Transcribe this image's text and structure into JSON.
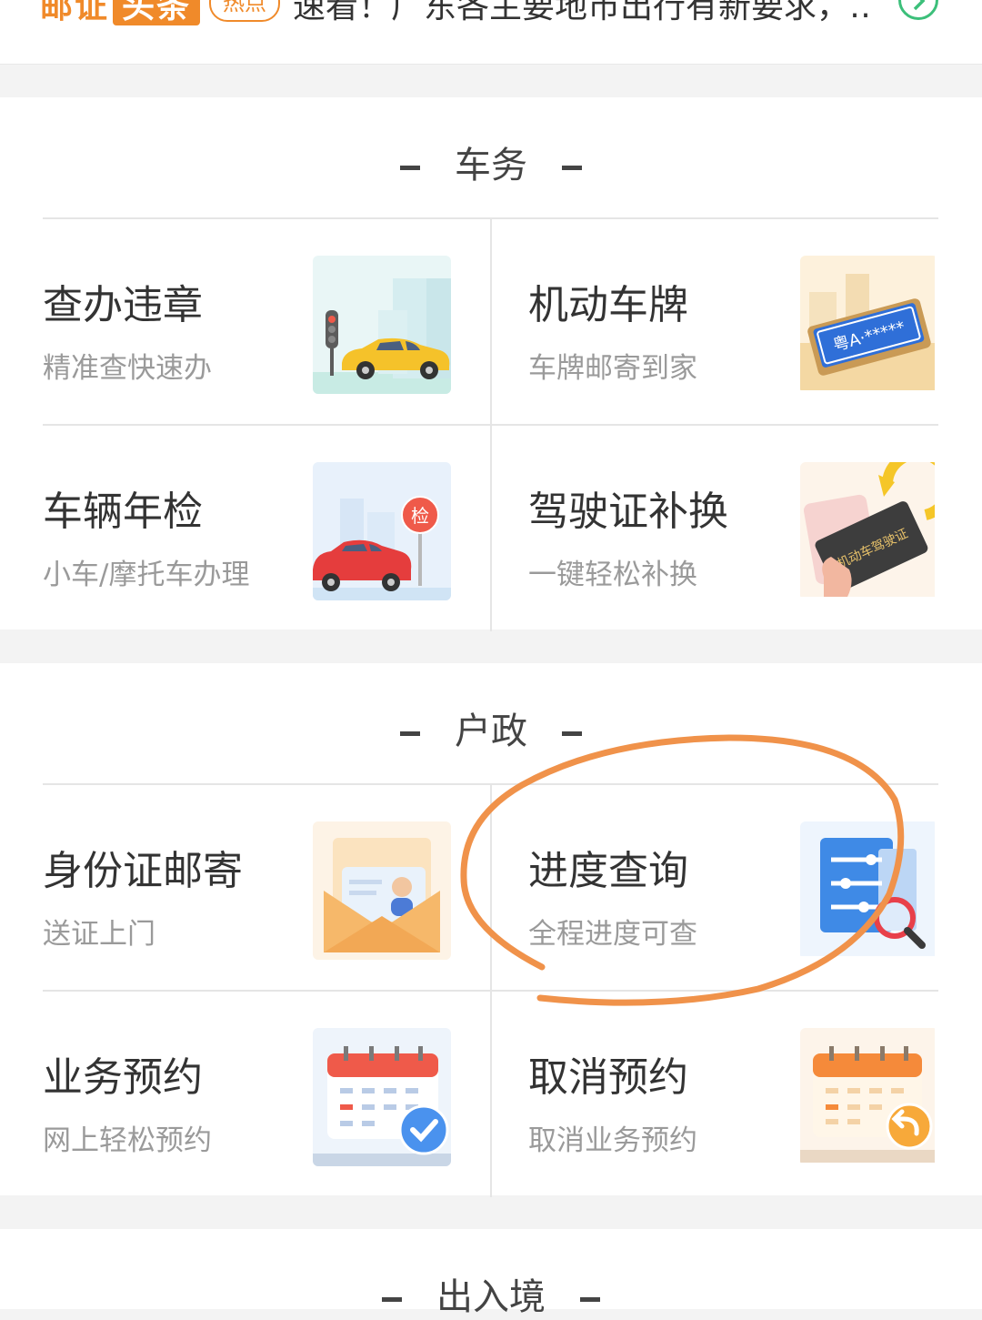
{
  "news": {
    "brand_part1": "邮证",
    "brand_part2": "头条",
    "hot_badge": "热点",
    "headline": "速看！广东各主要地市出行有新要求，…"
  },
  "sections": {
    "vehicle": {
      "title": "车务",
      "items": [
        {
          "title": "查办违章",
          "subtitle": "精准查快速办",
          "icon": "traffic-light-car-icon"
        },
        {
          "title": "机动车牌",
          "subtitle": "车牌邮寄到家",
          "icon": "license-plate-icon"
        },
        {
          "title": "车辆年检",
          "subtitle": "小车/摩托车办理",
          "icon": "inspection-car-icon"
        },
        {
          "title": "驾驶证补换",
          "subtitle": "一键轻松补换",
          "icon": "driver-license-icon"
        }
      ],
      "image_text": {
        "sign": "检",
        "plate": "粤A·*****",
        "license": "机动车驾驶证"
      }
    },
    "household": {
      "title": "户政",
      "items": [
        {
          "title": "身份证邮寄",
          "subtitle": "送证上门",
          "icon": "id-card-envelope-icon"
        },
        {
          "title": "进度查询",
          "subtitle": "全程进度可查",
          "icon": "progress-search-icon"
        },
        {
          "title": "业务预约",
          "subtitle": "网上轻松预约",
          "icon": "calendar-check-icon"
        },
        {
          "title": "取消预约",
          "subtitle": "取消业务预约",
          "icon": "calendar-undo-icon"
        }
      ]
    },
    "exit_entry": {
      "title": "出入境"
    }
  },
  "colors": {
    "brand": "#f08a2a",
    "annotation": "#f0924a",
    "accent_green": "#3cbf7a"
  }
}
